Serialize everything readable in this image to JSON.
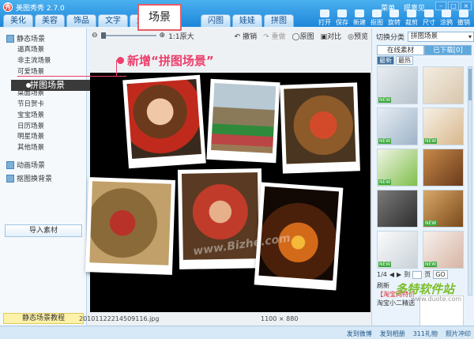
{
  "app": {
    "title": "美图秀秀 2.7.0"
  },
  "top_links": [
    "菜单",
    "提意见"
  ],
  "tabs": [
    "美化",
    "美容",
    "饰品",
    "文字",
    "边框",
    "场景",
    "闪图",
    "娃娃",
    "拼图"
  ],
  "active_tab": "场景",
  "toolbar": [
    "打开",
    "保存",
    "新建",
    "抠图",
    "旋转",
    "裁剪",
    "尺寸",
    "涂鸦",
    "撤销"
  ],
  "left_panel": {
    "title": "静态场景",
    "items": [
      "逼真场景",
      "非主流场景",
      "可爱场景",
      "拼图场景",
      "桌面场景",
      "节日贺卡",
      "宝宝场景",
      "日历场景",
      "明星场景",
      "其他场景"
    ],
    "selected": "拼图场景",
    "dynamic": "动画场景",
    "cutout": "抠图换背景",
    "import_button": "导入素材",
    "tutorial": "静态场景教程"
  },
  "canvas": {
    "zoom_label": "1:1原大",
    "undo": "撤销",
    "redo": "重做",
    "original": "原图",
    "compare": "对比",
    "preview": "预览",
    "callout": "新增“拼图场景”",
    "watermark": "www.Bizhe.com",
    "filename": "20101122214509116.jpg",
    "dimensions": "1100 × 880"
  },
  "right_panel": {
    "category_label": "切换分类",
    "category_value": "拼图场景",
    "tab_online": "在线素材",
    "tab_downloaded": "已下载[0]",
    "sort_new": "最新",
    "sort_hot": "最热",
    "new_badge": "NEW",
    "page_current": "1/4",
    "page_jump_label": "到",
    "page_unit": "页",
    "go": "GO",
    "bottom_line1": "刷新",
    "promo": "【淘宝网特价",
    "promo2": "淘宝小二精选"
  },
  "site_mark": {
    "logo": "多特软件站",
    "sub": "www.duote.com"
  },
  "status": {
    "send_weibo": "发到微博",
    "send_album": "发到相册",
    "gift": "311礼物",
    "photos": "照片冲印"
  }
}
